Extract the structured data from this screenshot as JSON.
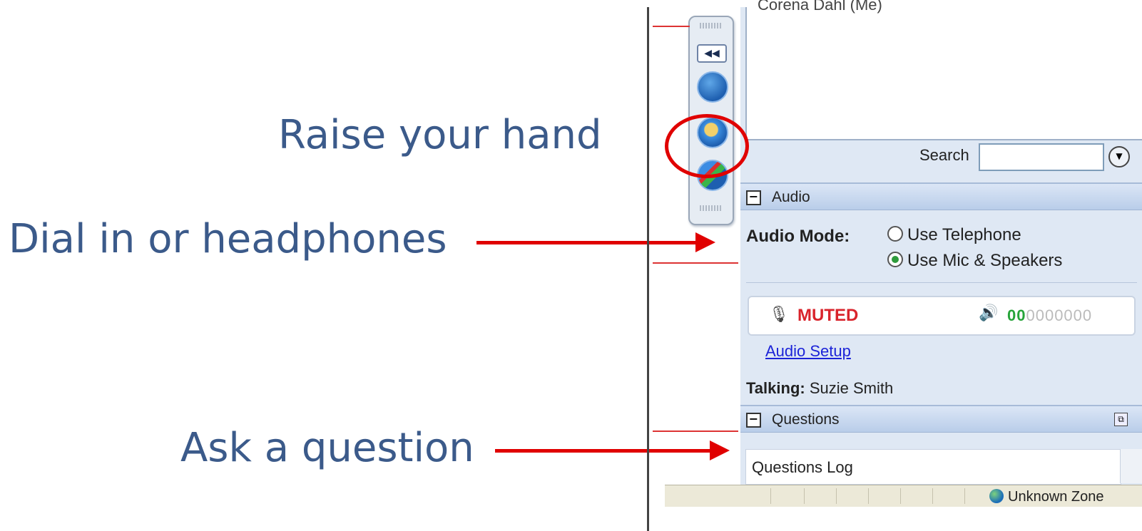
{
  "callouts": {
    "raise_hand": "Raise your hand",
    "dial_in": "Dial in or headphones",
    "ask_question": "Ask a question"
  },
  "attendee_list": {
    "partial_name": "Corena Dahl (Me)"
  },
  "search": {
    "label": "Search",
    "value": ""
  },
  "audio": {
    "section_title": "Audio",
    "mode_label": "Audio Mode:",
    "options": [
      "Use Telephone",
      "Use Mic & Speakers"
    ],
    "selected_option": "Use Mic & Speakers",
    "mute_status": "MUTED",
    "meter_on": "00",
    "meter_off": "0000000",
    "setup_link": "Audio Setup",
    "talking_label": "Talking:",
    "talking_name": "Suzie Smith"
  },
  "questions": {
    "section_title": "Questions",
    "log_label": "Questions Log"
  },
  "statusbar": {
    "zone": "Unknown Zone"
  },
  "colors": {
    "callout_text": "#3b5a8a",
    "annotation_red": "#e00000",
    "muted_red": "#d9242c",
    "link_blue": "#1c23d8",
    "panel_bg": "#dfe8f4"
  },
  "icons": {
    "toolbar": [
      "grip-icon",
      "rewind-icon",
      "window-icon",
      "raise-hand-icon",
      "status-icon",
      "grip-icon"
    ],
    "audio": [
      "microphone-icon",
      "speaker-icon"
    ],
    "search": "dropdown-arrow-icon"
  }
}
